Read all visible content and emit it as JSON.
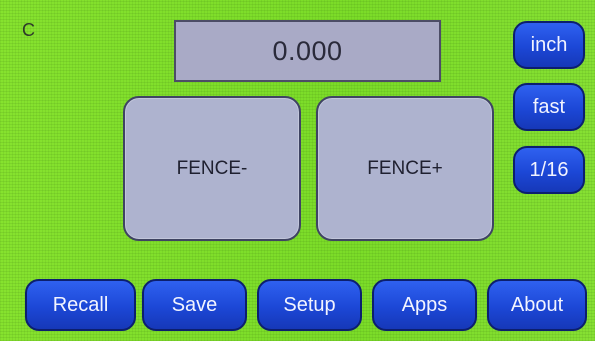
{
  "status": {
    "mode_letter": "C"
  },
  "readout": {
    "value": "0.000"
  },
  "jog": {
    "minus_label": "FENCE-",
    "plus_label": "FENCE+"
  },
  "side": {
    "units_label": "inch",
    "speed_label": "fast",
    "step_label": "1/16"
  },
  "nav": {
    "recall_label": "Recall",
    "save_label": "Save",
    "setup_label": "Setup",
    "apps_label": "Apps",
    "about_label": "About"
  },
  "colors": {
    "screen_background": "#7fe02a",
    "button_blue": "#1f4fe0",
    "panel_gray": "#aeb3cf"
  }
}
